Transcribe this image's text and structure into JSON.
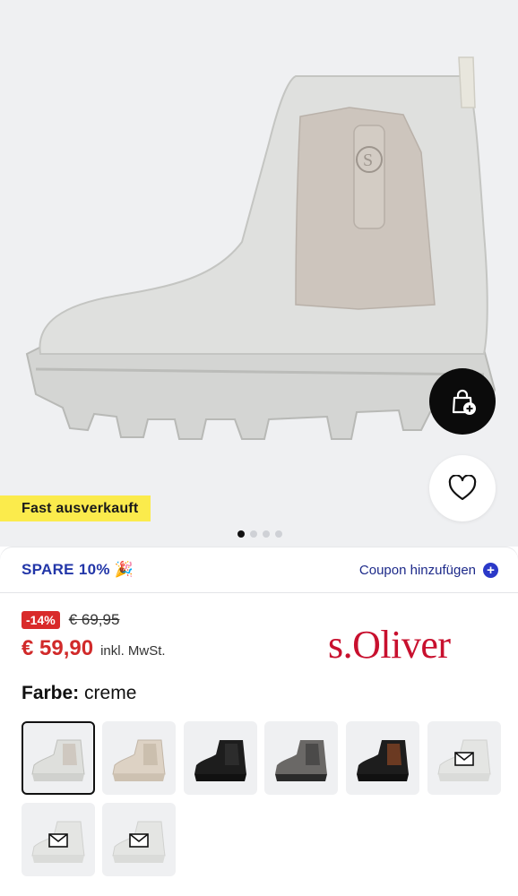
{
  "badge": {
    "sold_out_label": "Fast ausverkauft"
  },
  "gallery": {
    "dots": 4,
    "active_index": 0
  },
  "coupon": {
    "spare_label": "SPARE 10% 🎉",
    "add_label": "Coupon hinzufügen"
  },
  "price": {
    "discount": "-14%",
    "old": "€ 69,95",
    "current": "€ 59,90",
    "vat_note": "inkl. MwSt."
  },
  "brand": {
    "name": "s.Oliver",
    "color": "#c8102e"
  },
  "color_selector": {
    "label_key": "Farbe:",
    "label_value": "creme"
  },
  "swatches": [
    {
      "name": "creme",
      "selected": true
    },
    {
      "name": "beige"
    },
    {
      "name": "black"
    },
    {
      "name": "gunmetal"
    },
    {
      "name": "black-pattern"
    },
    {
      "name": "unavailable-1",
      "notify": true
    },
    {
      "name": "unavailable-2",
      "notify": true
    },
    {
      "name": "unavailable-3",
      "notify": true
    }
  ],
  "colors": {
    "accent_blue": "#2b39c8",
    "price_red": "#d12a2a",
    "badge_yellow": "#fbeb4c"
  }
}
